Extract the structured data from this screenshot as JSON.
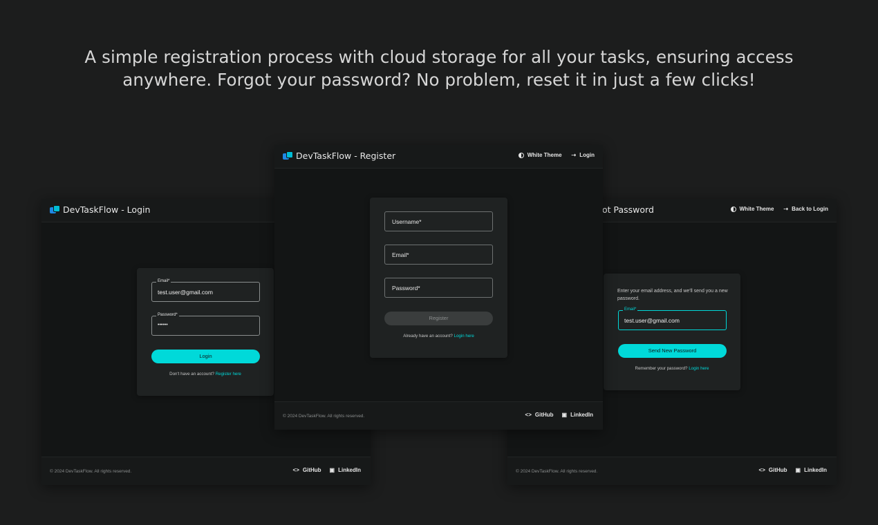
{
  "headline": "A simple registration process with cloud storage for all your tasks, ensuring access anywhere. Forgot your password? No problem, reset it in just a few clicks!",
  "colors": {
    "accent": "#00d9d9",
    "background": "#1c1d1d",
    "panel": "#131515",
    "card": "#1f2222"
  },
  "icons": {
    "logo": "app-logo-icon",
    "theme": "contrast-icon",
    "login": "login-arrow-icon",
    "github": "code-icon",
    "linkedin": "briefcase-icon"
  },
  "footer": {
    "copyright": "© 2024 DevTaskFlow. All rights reserved.",
    "github": "GitHub",
    "linkedin": "LinkedIn"
  },
  "login": {
    "title": "DevTaskFlow - Login",
    "email_label": "Email*",
    "email_value": "test.user@gmail.com",
    "password_label": "Password*",
    "password_value": "••••••",
    "button": "Login",
    "note": "Don't have an account?",
    "note_link": "Register here"
  },
  "register": {
    "title": "DevTaskFlow - Register",
    "theme_toggle": "White Theme",
    "login_link": "Login",
    "username_placeholder": "Username*",
    "email_placeholder": "Email*",
    "password_placeholder": "Password*",
    "button": "Register",
    "note": "Already have an account?",
    "note_link": "Login here"
  },
  "forgot": {
    "title_visible": "ot Password",
    "theme_toggle": "White Theme",
    "back_link": "Back to Login",
    "description": "Enter your email address, and we'll send you a new password.",
    "email_label": "Email*",
    "email_value": "test.user@gmail.com",
    "button": "Send New Password",
    "note": "Remember your password?",
    "note_link": "Login here"
  }
}
